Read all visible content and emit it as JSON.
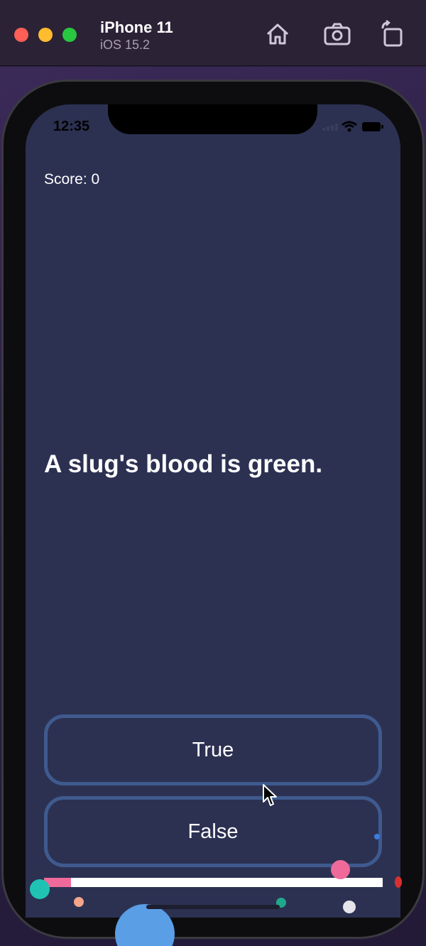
{
  "simulator": {
    "device_name": "iPhone 11",
    "os_version": "iOS 15.2",
    "toolbar_icons": [
      "home-icon",
      "screenshot-icon",
      "rotate-icon"
    ]
  },
  "status_bar": {
    "time": "12:35",
    "icons": [
      "signal-icon",
      "wifi-icon",
      "battery-icon"
    ]
  },
  "quiz": {
    "score_text": "Score: 0",
    "question": "A slug's blood is green.",
    "true_label": "True",
    "false_label": "False",
    "progress": 0.08
  },
  "colors": {
    "screen_bg": "#2c3152",
    "button_border": "#3f5a8e",
    "progress_fill": "#ef6a9a",
    "progress_track": "#ffffff"
  }
}
